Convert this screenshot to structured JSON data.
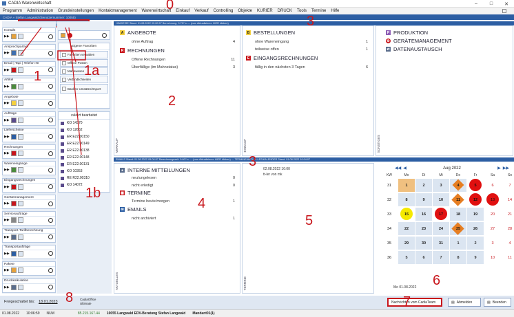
{
  "window": {
    "title": "CADIA Warenwirtschaft"
  },
  "menu": [
    "Programm",
    "Administration",
    "Grundeinstellungen",
    "Kontaktmanagement",
    "Warenwirtschaft",
    "Einkauf",
    "Verkauf",
    "Controlling",
    "Objekte",
    "KURIER",
    "DRUCK",
    "Tools",
    "Termine",
    "Hilfe"
  ],
  "path_text": "CADIA » Stefan Langwald (Benutzernummer: 10055)",
  "quickmenu": {
    "label": "QUICKMENU einrichten"
  },
  "sidebar": [
    {
      "title": "Kontakt"
    },
    {
      "title": "Ansprechpartner"
    },
    {
      "title": "Email | Tapi | Telefon-Nr"
    },
    {
      "title": "Artikel"
    },
    {
      "title": "Angebote"
    },
    {
      "title": "Aufträge"
    },
    {
      "title": "Lieferscheine"
    },
    {
      "title": "Rechnungen"
    },
    {
      "title": "Wareneingänge"
    },
    {
      "title": "Eingangsrechnungen"
    },
    {
      "title": "Gerätemanagement"
    },
    {
      "title": "Serviceaufträge"
    },
    {
      "title": "Transport-Tarifberechnung"
    },
    {
      "title": "Transportaufträge"
    },
    {
      "title": "Pakete"
    },
    {
      "title": "Druckkalkulation"
    }
  ],
  "favorites": {
    "title": "Eigene Favoriten",
    "items": [
      "Favoriten verwalten",
      "Offene Posten",
      "Mahnwesen",
      "Verbindlichkeiten",
      "Banken Umsätze/Import"
    ]
  },
  "recent": {
    "title": "zuletzt  bearbeitet",
    "items": [
      "KO 14370",
      "KO 12662",
      "ER E22.00150",
      "ER E22.00149",
      "ER E22.00138",
      "ER E22.00148",
      "ER E22.00131",
      "KO 10353",
      "RE R22.00310",
      "KO 14072"
    ]
  },
  "strip_top": "HINWEISE Stand: 01.08.2022 09:00:57  Berechnung: 0:75? s — (zum Aktualisieren HIER klicken)",
  "strip_mid": "EMAILS Stand: 01.08.2022 09:00:57  Berechnungszeit: 0:60? s — (zum Aktualisieren HIER klicken) — TERMINE/AKTUELLES/KALENDER Stand: 01.08.2022 10:04:07",
  "verkauf": {
    "label": "VERKAUF",
    "angebote": {
      "title": "ANGEBOTE",
      "rows": [
        {
          "label": "ohne Auftrag",
          "value": "4"
        }
      ]
    },
    "rechnungen": {
      "title": "RECHNUNGEN",
      "rows": [
        {
          "label": "Offene Rechnungen",
          "value": "11"
        },
        {
          "label": "Überfällige (im Mahnstatus)",
          "value": "3"
        }
      ]
    }
  },
  "einkauf": {
    "label": "EINKAUF",
    "bestellungen": {
      "title": "BESTELLUNGEN",
      "rows": [
        {
          "label": "ohne Wareneingang",
          "value": "1"
        },
        {
          "label": "teilweise offen",
          "value": "1"
        }
      ]
    },
    "eingangsrechnungen": {
      "title": "EINGANGSRECHNUNGEN",
      "rows": [
        {
          "label": "fällig in den nächsten 3 Tagen",
          "value": "6"
        }
      ]
    }
  },
  "sonstiges": {
    "label": "SONSTIGES",
    "items": [
      "PRODUKTION",
      "GERÄTEMANAGEMENT",
      "DATENAUSTAUSCH"
    ]
  },
  "aktuelles": {
    "label": "AKTUELLES",
    "interne": {
      "title": "INTERNE MITTEILUNGEN",
      "rows": [
        {
          "label": "neu/ungelesen",
          "value": "0"
        },
        {
          "label": "nicht erledigt",
          "value": "0"
        }
      ]
    },
    "termine": {
      "title": "TERMINE",
      "rows": [
        {
          "label": "Termine heute/morgen",
          "value": "1"
        }
      ]
    },
    "emails": {
      "title": "EMAILS",
      "rows": [
        {
          "label": "nicht archiviert",
          "value": "1"
        }
      ]
    }
  },
  "termine_panel": {
    "label": "TERMINE",
    "date": "02.08.2022 10:00",
    "text": "tt-ler von mk"
  },
  "calendar": {
    "month": "Aug 2022",
    "headers": [
      "KW",
      "Mo",
      "Di",
      "Mi",
      "Do",
      "Fr",
      "Sa",
      "So"
    ],
    "weeks": [
      {
        "kw": "31",
        "days": [
          "1",
          "2",
          "3",
          "4",
          "5",
          "6",
          "7"
        ]
      },
      {
        "kw": "32",
        "days": [
          "8",
          "9",
          "10",
          "11",
          "12",
          "13",
          "14"
        ]
      },
      {
        "kw": "33",
        "days": [
          "15",
          "16",
          "17",
          "18",
          "19",
          "20",
          "21"
        ]
      },
      {
        "kw": "34",
        "days": [
          "22",
          "23",
          "24",
          "25",
          "26",
          "27",
          "28"
        ]
      },
      {
        "kw": "35",
        "days": [
          "29",
          "30",
          "31",
          "1",
          "2",
          "3",
          "4"
        ]
      },
      {
        "kw": "36",
        "days": [
          "5",
          "6",
          "7",
          "8",
          "9",
          "10",
          "11"
        ]
      }
    ],
    "footer": "Mo 01.08.2022"
  },
  "bottom": {
    "freigeschaltet_label": "Freigeschaltet bis:",
    "freigeschaltet_date": "18.01.2023",
    "edition": "CadiaOffice Ultimate",
    "btn_news": "Nachrichten vom CadiaTeam",
    "btn_logout": "Abmelden",
    "btn_quit": "Beenden"
  },
  "status": {
    "date": "01.08.2022",
    "time": "10:06:59",
    "num": "NUM",
    "ip": "85.215.167.44",
    "company": "10055 Langwald EDV-Beratung Stefan Langwald",
    "mandant": "Mandant01(1)"
  },
  "annotations": [
    "0",
    "1",
    "1a",
    "1b",
    "2",
    "3",
    "3",
    "4",
    "5",
    "6",
    "7",
    "8"
  ]
}
